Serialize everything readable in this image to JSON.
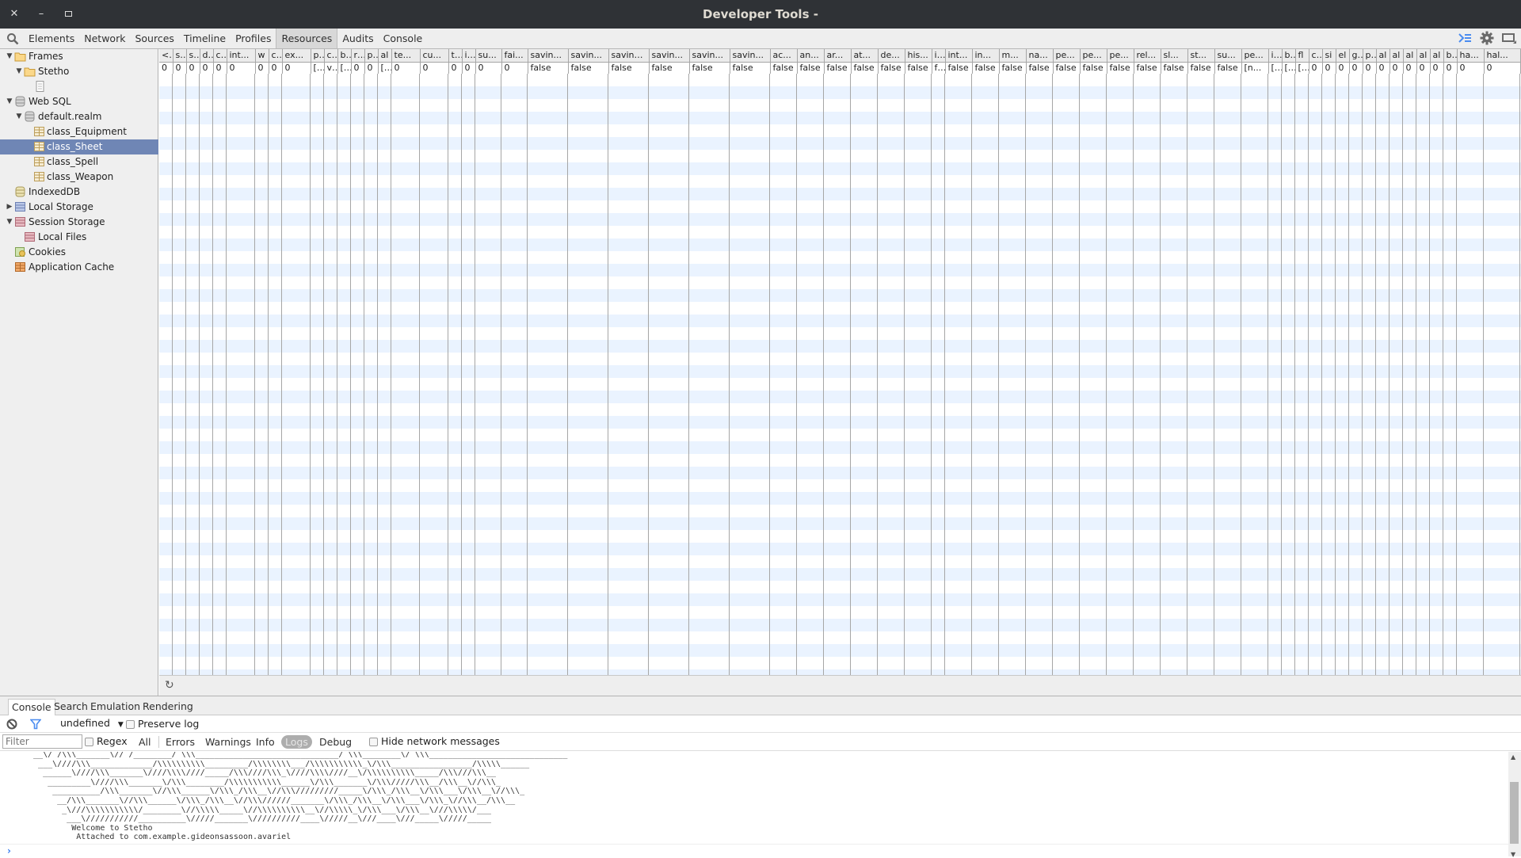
{
  "window": {
    "title": "Developer Tools -",
    "controls": [
      "close",
      "minimize",
      "maximize"
    ]
  },
  "toolbar": {
    "tabs": [
      {
        "label": "Elements",
        "selected": false
      },
      {
        "label": "Network",
        "selected": false
      },
      {
        "label": "Sources",
        "selected": false
      },
      {
        "label": "Timeline",
        "selected": false
      },
      {
        "label": "Profiles",
        "selected": false
      },
      {
        "label": "Resources",
        "selected": true
      },
      {
        "label": "Audits",
        "selected": false
      },
      {
        "label": "Console",
        "selected": false
      }
    ],
    "right_icons": [
      "show-drawer-icon",
      "settings-gear-icon",
      "dock-icon"
    ]
  },
  "sidebar": {
    "items": [
      {
        "label": "Frames",
        "icon": "folder-icon",
        "expanded": true,
        "level": 0
      },
      {
        "label": "Stetho",
        "icon": "folder-icon",
        "expanded": true,
        "level": 1
      },
      {
        "label": "",
        "icon": "document-icon",
        "level": 2
      },
      {
        "label": "Web SQL",
        "icon": "database-icon",
        "expanded": true,
        "level": 0
      },
      {
        "label": "default.realm",
        "icon": "database-icon",
        "expanded": true,
        "level": 1
      },
      {
        "label": "class_Equipment",
        "icon": "table-icon",
        "level": 2
      },
      {
        "label": "class_Sheet",
        "icon": "table-icon",
        "level": 2,
        "selected": true
      },
      {
        "label": "class_Spell",
        "icon": "table-icon",
        "level": 2
      },
      {
        "label": "class_Weapon",
        "icon": "table-icon",
        "level": 2
      },
      {
        "label": "IndexedDB",
        "icon": "indexeddb-icon",
        "level": 0
      },
      {
        "label": "Local Storage",
        "icon": "local-storage-icon",
        "expanded": false,
        "level": 0
      },
      {
        "label": "Session Storage",
        "icon": "session-storage-icon",
        "expanded": true,
        "level": 0
      },
      {
        "label": "Local Files",
        "icon": "session-storage-icon",
        "level": 1
      },
      {
        "label": "Cookies",
        "icon": "cookie-icon",
        "level": 0
      },
      {
        "label": "Application Cache",
        "icon": "app-cache-icon",
        "level": 0
      }
    ]
  },
  "grid": {
    "columns": [
      "<i",
      "st",
      "st",
      "di",
      "cc",
      "int...",
      "w",
      "ch",
      "ex...",
      "pl",
      "ch",
      "bi",
      "ra",
      "pl",
      "al",
      "te...",
      "cu...",
      "tc",
      "in",
      "su...",
      "fai...",
      "savin...",
      "savin...",
      "saving...",
      "savin...",
      "savin...",
      "savin...",
      "ac...",
      "an...",
      "ar...",
      "at...",
      "de...",
      "his...",
      "in",
      "int...",
      "in...",
      "m...",
      "na...",
      "pe...",
      "pe...",
      "pe...",
      "rel...",
      "sl...",
      "st...",
      "su...",
      "pe...",
      "id",
      "bo",
      "fl",
      "cc",
      "si",
      "el",
      "gi",
      "pl",
      "al",
      "al",
      "al",
      "al",
      "al",
      "bi",
      "ha...",
      "hal..."
    ],
    "rows": [
      [
        "0",
        "0",
        "0",
        "0",
        "0",
        "0",
        "0",
        "0",
        "0",
        "[nu",
        "vic",
        "[nu",
        "0",
        "0",
        "[nu",
        "0",
        "0",
        "0",
        "0",
        "0",
        "0",
        "false",
        "false",
        "false",
        "false",
        "false",
        "false",
        "false",
        "false",
        "false",
        "false",
        "false",
        "false",
        "fal",
        "false",
        "false",
        "false",
        "false",
        "false",
        "false",
        "false",
        "false",
        "false",
        "false",
        "false",
        "[n...",
        "[nu",
        "[nu",
        "[nu",
        "0",
        "0",
        "0",
        "0",
        "0",
        "0",
        "0",
        "0",
        "0",
        "0",
        "0",
        "0",
        "0"
      ]
    ],
    "refresh_icon": "refresh-icon"
  },
  "drawer": {
    "tabs": [
      {
        "label": "Console",
        "selected": true
      },
      {
        "label": "Search",
        "selected": false
      },
      {
        "label": "Emulation",
        "selected": false
      },
      {
        "label": "Rendering",
        "selected": false
      }
    ],
    "context_select": "undefined",
    "preserve_log_label": "Preserve log",
    "filter_placeholder": "Filter",
    "regex_label": "Regex",
    "levels": [
      {
        "label": "All",
        "selected": false
      },
      {
        "label": "Errors",
        "selected": false
      },
      {
        "label": "Warnings",
        "selected": false
      },
      {
        "label": "Info",
        "selected": false
      },
      {
        "label": "Logs",
        "selected": true
      },
      {
        "label": "Debug",
        "selected": false
      }
    ],
    "hide_network_label": "Hide network messages",
    "console_lines": [
      "  __\\/ /\\\\\\_______\\// /________/ \\\\\\______________________________/ \\\\\\________\\/ \\\\\\_____________________________",
      "   ___\\////\\\\\\_____________/\\\\\\\\\\\\\\\\\\\\_________/\\\\\\\\\\\\\\\\___/\\\\\\\\\\\\\\\\\\\\\\_\\/\\\\\\_________________/\\\\\\\\\\______",
      "    ______\\////\\\\\\_______\\////\\\\\\\\////_____/\\\\\\////\\\\\\_\\////\\\\\\\\////__\\/\\\\\\\\\\\\\\\\\\\\_____/\\\\\\///\\\\\\__",
      "     _________\\////\\\\\\_______\\/\\\\\\________/\\\\\\\\\\\\\\\\\\\\\\______\\/\\\\\\_______\\/\\\\\\/////\\\\\\__/\\\\\\__\\//\\\\\\_",
      "      __________/\\\\\\_______\\//\\\\\\______\\/\\\\\\_/\\\\\\__\\//\\\\\\/////////_____\\/\\\\\\_/\\\\\\__\\/\\\\\\___\\/\\\\\\__\\//\\\\\\_",
      "       __/\\\\\\_______\\//\\\\\\______\\/\\\\\\_/\\\\\\__\\//\\\\\\//////_______\\/\\\\\\_/\\\\\\__\\/\\\\\\___\\/\\\\\\_\\//\\\\\\__/\\\\\\__",
      "        _\\///\\\\\\\\\\\\\\\\\\\\\\/________\\//\\\\\\\\\\_____\\//\\\\\\\\\\\\\\\\\\\\__\\//\\\\\\\\\\_\\/\\\\\\___\\/\\\\\\__\\///\\\\\\\\\\/___",
      "         ___\\///////////__________\\/////_______\\//////////____\\/////__\\///____\\///_____\\/////_____",
      "          Welcome to Stetho",
      "           Attached to com.example.gideonsassoon.avariel"
    ]
  }
}
